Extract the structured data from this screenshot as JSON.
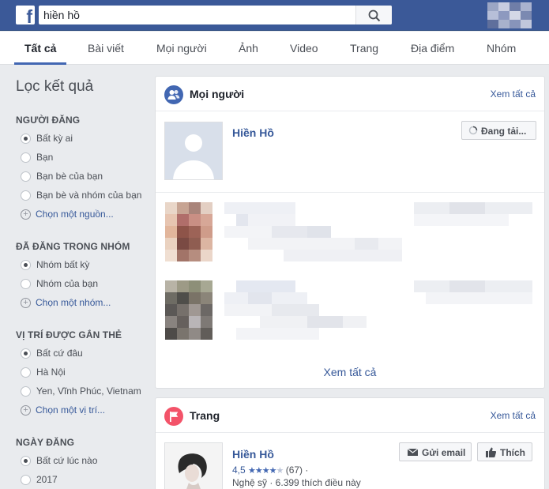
{
  "search": {
    "query": "hiền hồ"
  },
  "tabs": [
    {
      "label": "Tất cả"
    },
    {
      "label": "Bài viết"
    },
    {
      "label": "Mọi người"
    },
    {
      "label": "Ảnh"
    },
    {
      "label": "Video"
    },
    {
      "label": "Trang"
    },
    {
      "label": "Địa điểm"
    },
    {
      "label": "Nhóm"
    }
  ],
  "sidebar": {
    "title": "Lọc kết quả",
    "sections": [
      {
        "heading": "NGƯỜI ĐĂNG",
        "options": [
          "Bất kỳ ai",
          "Bạn",
          "Bạn bè của bạn",
          "Bạn bè và nhóm của bạn"
        ],
        "choose": "Chọn một nguồn..."
      },
      {
        "heading": "ĐÃ ĐĂNG TRONG NHÓM",
        "options": [
          "Nhóm bất kỳ",
          "Nhóm của bạn"
        ],
        "choose": "Chọn một nhóm..."
      },
      {
        "heading": "VỊ TRÍ ĐƯỢC GẮN THẺ",
        "options": [
          "Bất cứ đâu",
          "Hà Nội",
          "Yen, Vĩnh Phúc, Vietnam"
        ],
        "choose": "Chọn một vị trí..."
      },
      {
        "heading": "NGÀY ĐĂNG",
        "options": [
          "Bất cứ lúc nào",
          "2017"
        ]
      }
    ]
  },
  "people_card": {
    "title": "Mọi người",
    "see_all_top": "Xem tất cả",
    "first_result_name": "Hiền Hồ",
    "loading_button": "Đang tải...",
    "see_all_bottom": "Xem tất cả"
  },
  "pages_card": {
    "title": "Trang",
    "see_all_top": "Xem tất cả",
    "page_name": "Hiền Hồ",
    "rating": "4,5",
    "rating_stars": 4.5,
    "review_count": "(67) ·",
    "subtitle": "Nghệ sỹ · 6.399 thích điều này",
    "email_button": "Gửi email",
    "like_button": "Thích"
  },
  "colors": {
    "brand": "#3b5998",
    "link": "#365899",
    "people_icon": "#4267b2",
    "pages_icon": "#f35369"
  }
}
